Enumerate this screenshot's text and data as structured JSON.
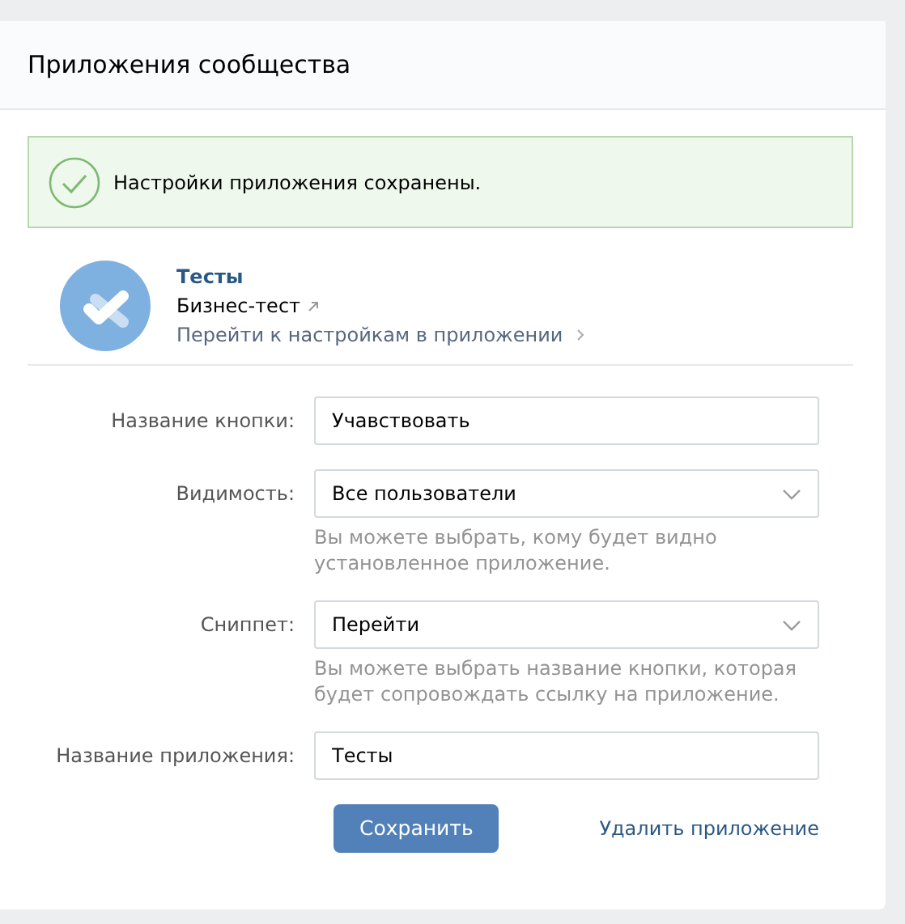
{
  "header": {
    "title": "Приложения сообщества"
  },
  "alert": {
    "text": "Настройки приложения сохранены."
  },
  "app": {
    "name": "Тесты",
    "subtitle": "Бизнес-тест",
    "settings_link": "Перейти к настройкам в приложении"
  },
  "fields": [
    {
      "kind": "text",
      "label": "Название кнопки:",
      "value": "Учавствовать"
    },
    {
      "kind": "select",
      "label": "Видимость:",
      "value": "Все пользователи",
      "hint": "Вы можете выбрать, кому будет видно установленное приложение."
    },
    {
      "kind": "select",
      "label": "Сниппет:",
      "value": "Перейти",
      "hint": "Вы можете выбрать название кнопки, которая будет сопровождать ссылку на приложение."
    },
    {
      "kind": "text",
      "label": "Название приложения:",
      "value": "Тесты"
    }
  ],
  "actions": {
    "save": "Сохранить",
    "delete": "Удалить приложение"
  }
}
